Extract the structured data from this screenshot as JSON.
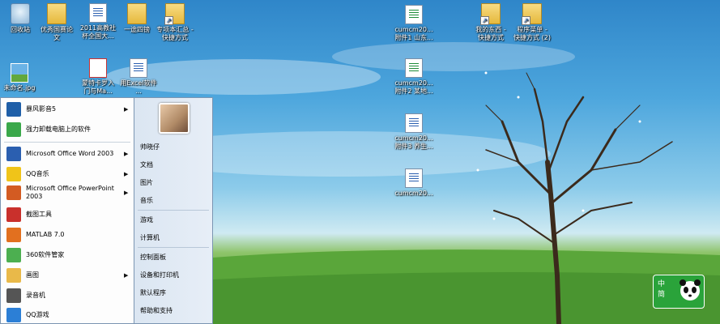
{
  "desktop_icons": [
    {
      "label": "回收站",
      "icon": "recycle-bin-icon"
    },
    {
      "label": "优秀国赛论\n文",
      "icon": "folder-icon"
    },
    {
      "label": "2011高教社\n杯全国大...",
      "icon": "word-doc-icon"
    },
    {
      "label": "一途四镑",
      "icon": "folder-icon"
    },
    {
      "label": "专项本汇总 -\n快捷方式",
      "icon": "shortcut-icon"
    },
    {
      "label": "cumcm20...\n附件1 山东...",
      "icon": "excel-doc-icon"
    },
    {
      "label": "我的东西 -\n快捷方式",
      "icon": "shortcut-icon"
    },
    {
      "label": "程序菜单 -\n快捷方式 (2)",
      "icon": "shortcut-icon"
    },
    {
      "label": "未命名.jpg",
      "icon": "image-file-icon"
    },
    {
      "label": "蒙特卡罗入\n门与Ma...",
      "icon": "pdf-doc-icon"
    },
    {
      "label": "用Excel软件\n...",
      "icon": "word-doc-icon"
    },
    {
      "label": "cumcm20...\n附件2 某地...",
      "icon": "excel-doc-icon"
    },
    {
      "label": "cumcm20...\n附件3 养生...",
      "icon": "word-doc-icon"
    },
    {
      "label": "cumcm20...",
      "icon": "word-doc-icon"
    }
  ],
  "start_menu": {
    "programs": [
      {
        "label": "暴风影音5",
        "has_submenu": true,
        "icon": "storm-player-icon",
        "color": "#1f5fa8"
      },
      {
        "label": "强力卸载电脑上的软件",
        "has_submenu": false,
        "icon": "uninstaller-icon",
        "color": "#3aa84a"
      },
      {
        "label": "Microsoft Office Word 2003",
        "has_submenu": true,
        "icon": "word-icon",
        "color": "#2b5fb0"
      },
      {
        "label": "QQ音乐",
        "has_submenu": true,
        "icon": "qq-music-icon",
        "color": "#f0c419"
      },
      {
        "label": "Microsoft Office PowerPoint\n2003",
        "has_submenu": true,
        "icon": "powerpoint-icon",
        "color": "#d35b22"
      },
      {
        "label": "截图工具",
        "has_submenu": false,
        "icon": "snipping-tool-icon",
        "color": "#c9302c"
      },
      {
        "label": "MATLAB 7.0",
        "has_submenu": false,
        "icon": "matlab-icon",
        "color": "#e2701f"
      },
      {
        "label": "360软件管家",
        "has_submenu": false,
        "icon": "360-manager-icon",
        "color": "#4caf50"
      },
      {
        "label": "画图",
        "has_submenu": true,
        "icon": "paint-icon",
        "color": "#e9b949"
      },
      {
        "label": "录音机",
        "has_submenu": false,
        "icon": "sound-recorder-icon",
        "color": "#555555"
      },
      {
        "label": "QQ游戏",
        "has_submenu": false,
        "icon": "qq-game-icon",
        "color": "#2c7fd6"
      }
    ],
    "right_items": [
      "帅晓仔",
      "文档",
      "图片",
      "音乐",
      "游戏",
      "计算机",
      "控制面板",
      "设备和打印机",
      "默认程序",
      "帮助和支持"
    ]
  },
  "tray_badge": {
    "label": "中\n简",
    "icon": "panda-ime-icon"
  }
}
